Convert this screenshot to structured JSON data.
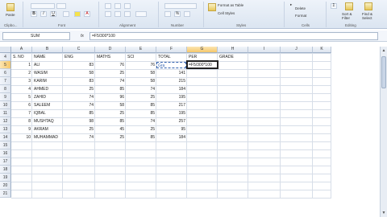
{
  "ribbon": {
    "clipboard_label": "Clipbo...",
    "paste_label": "Paste",
    "font_label": "Font",
    "alignment_label": "Alignment",
    "number_label": "Number",
    "styles_label": "Styles",
    "cells_label": "Cells",
    "editing_label": "Editing",
    "bold": "B",
    "italic": "I",
    "underline": "U",
    "format_as_table": "Format as Table",
    "cell_styles": "Cell Styles",
    "delete": "Delete",
    "format": "Format",
    "sort_filter": "Sort & Filter",
    "find_select": "Find & Select"
  },
  "formula_bar": {
    "name_box": "SUM",
    "fx": "fx",
    "formula": "=F5/300*100"
  },
  "columns": [
    "A",
    "B",
    "C",
    "D",
    "E",
    "F",
    "G",
    "H",
    "I",
    "J",
    "K"
  ],
  "rows": [
    "4",
    "5",
    "6",
    "7",
    "8",
    "9",
    "10",
    "11",
    "12",
    "13",
    "14",
    "15",
    "16",
    "17",
    "18",
    "19",
    "20",
    "21"
  ],
  "active_column": "G",
  "active_row": "5",
  "table": {
    "headers": [
      "S. NO",
      "NAME",
      "ENG",
      "MATHS",
      "SCI",
      "TOTAL",
      "PER",
      "GRADE"
    ],
    "records": [
      {
        "sno": "1",
        "name": "ALI",
        "eng": "83",
        "maths": "76",
        "sci": "76",
        "total": "",
        "per": "=F5/300*100"
      },
      {
        "sno": "2",
        "name": "WASIM",
        "eng": "58",
        "maths": "25",
        "sci": "58",
        "total": "141",
        "per": ""
      },
      {
        "sno": "3",
        "name": "KARIM",
        "eng": "83",
        "maths": "74",
        "sci": "58",
        "total": "215",
        "per": ""
      },
      {
        "sno": "4",
        "name": "AHMED",
        "eng": "25",
        "maths": "85",
        "sci": "74",
        "total": "184",
        "per": ""
      },
      {
        "sno": "5",
        "name": "ZAHID",
        "eng": "74",
        "maths": "96",
        "sci": "25",
        "total": "195",
        "per": ""
      },
      {
        "sno": "6",
        "name": "SALEEM",
        "eng": "74",
        "maths": "58",
        "sci": "85",
        "total": "217",
        "per": ""
      },
      {
        "sno": "7",
        "name": "IQBAL",
        "eng": "85",
        "maths": "25",
        "sci": "85",
        "total": "195",
        "per": ""
      },
      {
        "sno": "8",
        "name": "MUSHTAQ",
        "eng": "98",
        "maths": "85",
        "sci": "74",
        "total": "257",
        "per": ""
      },
      {
        "sno": "9",
        "name": "AKRAM",
        "eng": "25",
        "maths": "45",
        "sci": "25",
        "total": "95",
        "per": ""
      },
      {
        "sno": "10",
        "name": "MUHAMMAD",
        "eng": "74",
        "maths": "25",
        "sci": "85",
        "total": "184",
        "per": ""
      }
    ],
    "f5_overlay": "Gra"
  }
}
